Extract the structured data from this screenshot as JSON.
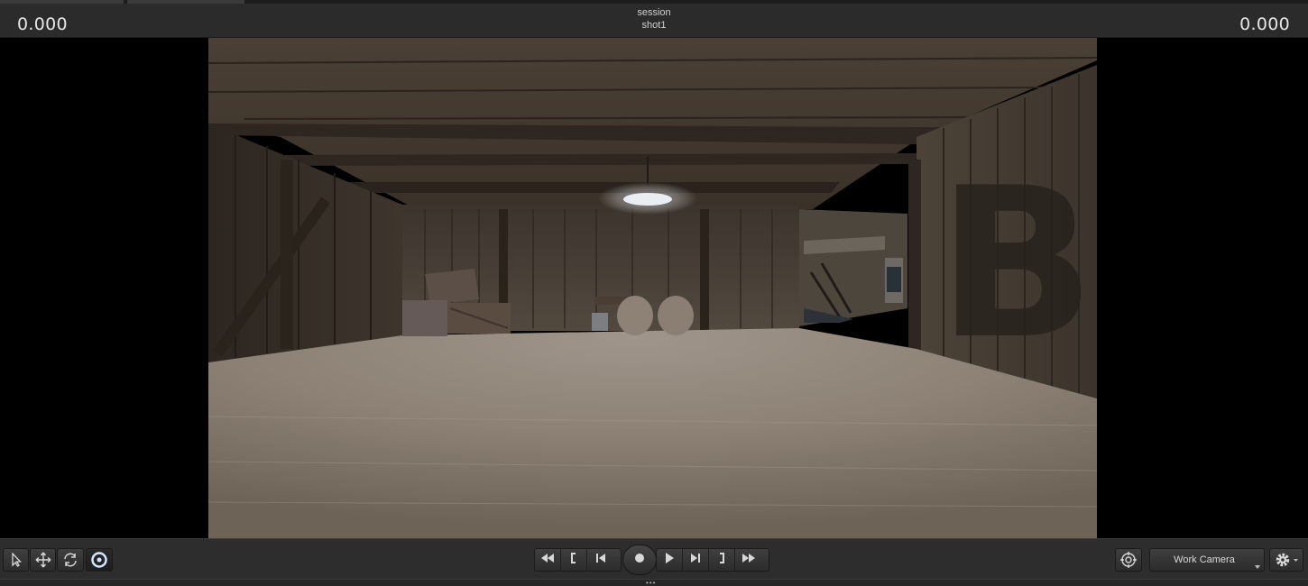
{
  "header": {
    "time_left": "0.000",
    "time_right": "0.000",
    "session_label": "session",
    "shot_label": "shot1"
  },
  "viewport": {
    "scene_letter": "B"
  },
  "toolbar": {
    "tools": [
      {
        "name": "select-tool",
        "icon": "arrow-pointer-icon"
      },
      {
        "name": "move-tool",
        "icon": "move-cross-arrows-icon"
      },
      {
        "name": "rotate-tool",
        "icon": "rotate-icon"
      },
      {
        "name": "orbit-tool",
        "icon": "target-circle-icon",
        "active": true
      }
    ],
    "transport": [
      "rewind-icon",
      "mark-in-icon",
      "step-back-icon",
      "record-icon",
      "play-icon",
      "step-forward-icon",
      "mark-out-icon",
      "fast-forward-icon"
    ],
    "camera_select": "Work Camera",
    "camera_target_icon": "crosshair-icon",
    "settings_icon": "gear-icon",
    "grip": "•••"
  },
  "colors": {
    "panel": "#2d2d2d",
    "header": "#2b2b2b",
    "active_tool_ring": "#cfe8ff"
  }
}
